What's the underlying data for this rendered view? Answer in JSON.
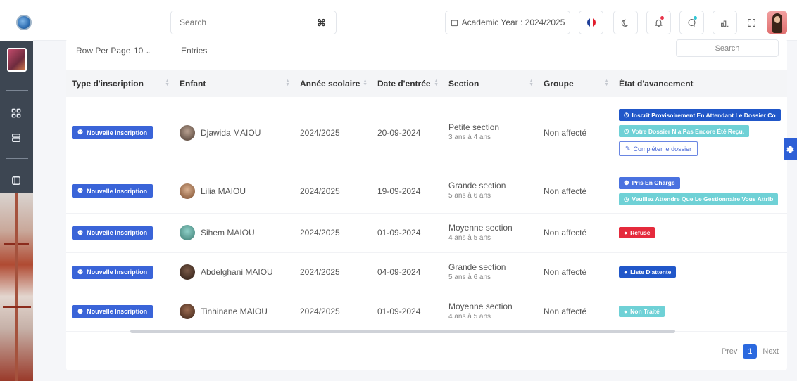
{
  "topbar": {
    "search_placeholder": "Search",
    "academic_year": "Academic Year : 2024/2025",
    "flag_colors": [
      "#1f3f99",
      "#ffffff",
      "#e11c2b"
    ]
  },
  "toolbar": {
    "rows_label": "Row Per Page",
    "rows_value": "10",
    "entries_label": "Entries",
    "search_placeholder": "Search"
  },
  "table": {
    "headers": [
      "Type d'inscription",
      "Enfant",
      "Année scolaire",
      "Date d'entrée",
      "Section",
      "Groupe",
      "État d'avancement"
    ],
    "rows": [
      {
        "type": "Nouvelle Inscription",
        "child": "Djawida MAIOU",
        "year": "2024/2025",
        "date": "20-09-2024",
        "section": "Petite section",
        "age": "3 ans à 4 ans",
        "group": "Non affecté",
        "status": [
          "Inscrit Provisoirement En Attendant Le Dossier Co",
          "Votre Dossier N'a Pas Encore Été Reçu."
        ],
        "action": "Compléter le dossier"
      },
      {
        "type": "Nouvelle Inscription",
        "child": "Lilia MAIOU",
        "year": "2024/2025",
        "date": "19-09-2024",
        "section": "Grande section",
        "age": "5 ans à 6 ans",
        "group": "Non affecté",
        "status": [
          "Pris En Charge",
          "Veuillez Attendre Que Le Gestionnaire Vous Attrib"
        ]
      },
      {
        "type": "Nouvelle Inscription",
        "child": "Sihem MAIOU",
        "year": "2024/2025",
        "date": "01-09-2024",
        "section": "Moyenne section",
        "age": "4 ans à 5 ans",
        "group": "Non affecté",
        "status": [
          "Refusé"
        ]
      },
      {
        "type": "Nouvelle Inscription",
        "child": "Abdelghani MAIOU",
        "year": "2024/2025",
        "date": "04-09-2024",
        "section": "Grande section",
        "age": "5 ans à 6 ans",
        "group": "Non affecté",
        "status": [
          "Liste D'attente"
        ]
      },
      {
        "type": "Nouvelle Inscription",
        "child": "Tinhinane MAIOU",
        "year": "2024/2025",
        "date": "01-09-2024",
        "section": "Moyenne section",
        "age": "4 ans à 5 ans",
        "group": "Non affecté",
        "status": [
          "Non Traité"
        ]
      }
    ]
  },
  "pagination": {
    "prev": "Prev",
    "page": "1",
    "next": "Next"
  }
}
